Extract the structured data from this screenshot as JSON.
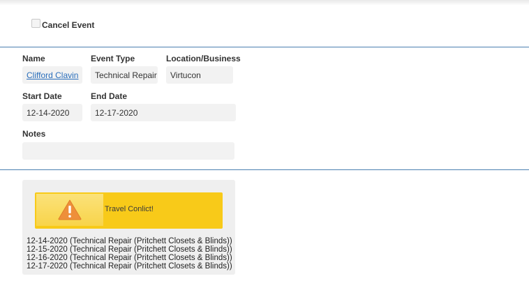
{
  "cancel_event": {
    "label": "Cancel Event",
    "checked": false
  },
  "details": {
    "name_label": "Name",
    "name_value": "Clifford Clavin",
    "event_type_label": "Event Type",
    "event_type_value": "Technical Repair",
    "location_label": "Location/Business",
    "location_value": "Virtucon",
    "start_date_label": "Start Date",
    "start_date_value": "12-14-2020",
    "end_date_label": "End Date",
    "end_date_value": "12-17-2020",
    "notes_label": "Notes",
    "notes_value": ""
  },
  "conflict": {
    "icon": "warning-icon",
    "message": "Travel Conlict!",
    "banner_color": "#f8ca19",
    "items": [
      "12-14-2020 (Technical Repair (Pritchett Closets & Blinds))",
      "12-15-2020 (Technical Repair (Pritchett Closets & Blinds))",
      "12-16-2020 (Technical Repair (Pritchett Closets & Blinds))",
      "12-17-2020 (Technical Repair (Pritchett Closets & Blinds))"
    ]
  },
  "colors": {
    "divider": "#4a7fb0",
    "link": "#2a6ebb",
    "field_bg": "#f2f2f2"
  }
}
